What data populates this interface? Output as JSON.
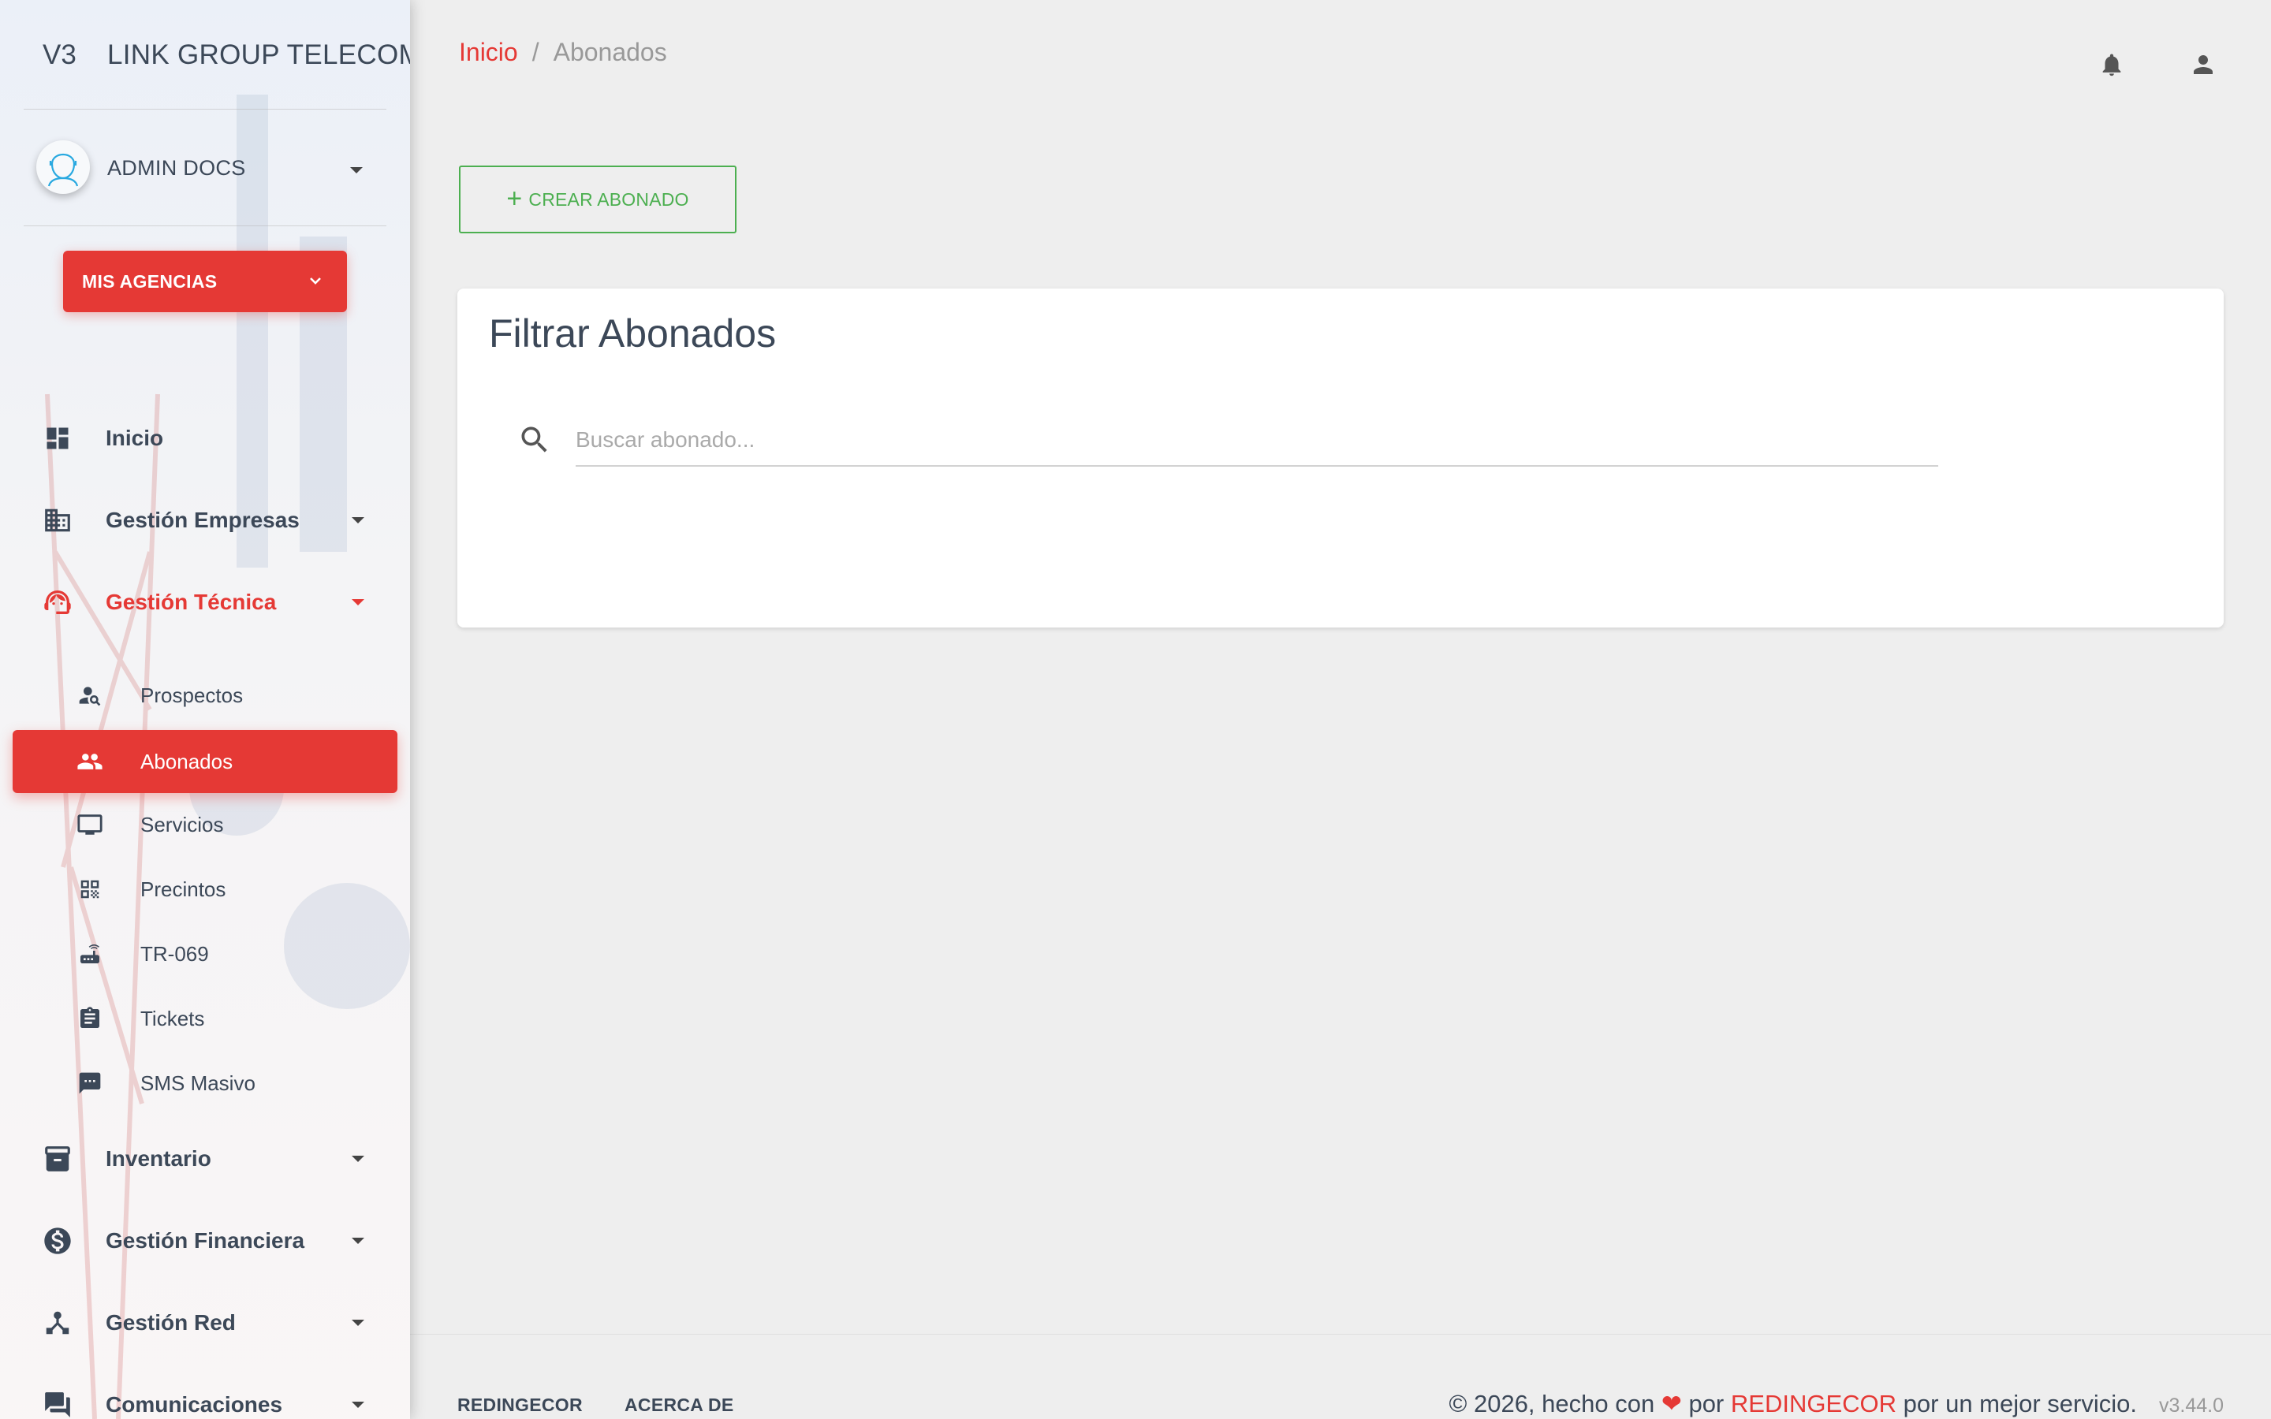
{
  "brand": {
    "mini": "V3",
    "full": "LINK GROUP TELECOMU"
  },
  "user": {
    "name": "ADMIN DOCS"
  },
  "agency_button": {
    "label": "MIS AGENCIAS"
  },
  "nav": {
    "inicio": "Inicio",
    "gestion_empresas": "Gestión Empresas",
    "gestion_tecnica": "Gestión Técnica",
    "sub": {
      "prospectos": "Prospectos",
      "abonados": "Abonados",
      "servicios": "Servicios",
      "precintos": "Precintos",
      "tr069": "TR-069",
      "tickets": "Tickets",
      "sms_masivo": "SMS Masivo"
    },
    "inventario": "Inventario",
    "gestion_financiera": "Gestión Financiera",
    "gestion_red": "Gestión Red",
    "comunicaciones": "Comunicaciones"
  },
  "breadcrumb": {
    "root": "Inicio",
    "sep": "/",
    "current": "Abonados"
  },
  "toolbar": {
    "create_label": "CREAR ABONADO"
  },
  "filter_card": {
    "title": "Filtrar Abonados",
    "search_placeholder": "Buscar abonado...",
    "search_value": ""
  },
  "footer": {
    "link1": "REDINGECOR",
    "link2": "ACERCA DE",
    "copy_prefix": "© 2026, hecho con",
    "heart": "❤",
    "copy_por": "por",
    "copy_brand": "REDINGECOR",
    "copy_suffix": "por un mejor servicio.",
    "version": "v3.44.0"
  },
  "colors": {
    "accent": "#e53935",
    "success": "#4caf50",
    "text": "#3c4858"
  },
  "icons": [
    "dashboard-icon",
    "domain-icon",
    "support-agent-icon",
    "person-search-icon",
    "people-icon",
    "monitor-icon",
    "qr-code-icon",
    "router-icon",
    "clipboard-icon",
    "sms-icon",
    "archive-icon",
    "dollar-icon",
    "network-icon",
    "forum-icon",
    "bell-icon",
    "person-icon",
    "search-icon"
  ]
}
